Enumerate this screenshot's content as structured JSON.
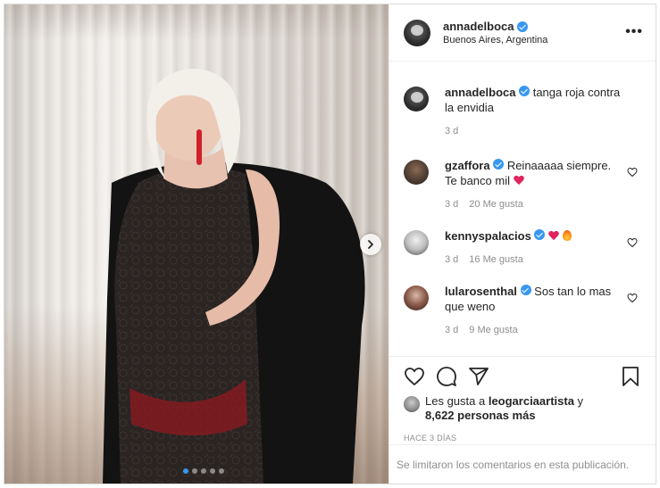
{
  "post": {
    "author": "annadelboca",
    "location": "Buenos Aires, Argentina",
    "more_label": "•••"
  },
  "comments": [
    {
      "user": "annadelboca",
      "text": "tanga roja contra la envidia",
      "time": "3 d",
      "likes": ""
    },
    {
      "user": "gzaffora",
      "text": "Reinaaaaa siempre. Te banco mil",
      "time": "3 d",
      "likes": "20 Me gusta"
    },
    {
      "user": "kennyspalacios",
      "text": "",
      "time": "3 d",
      "likes": "16 Me gusta"
    },
    {
      "user": "lularosenthal",
      "text": "Sos tan lo mas que weno",
      "time": "3 d",
      "likes": "9 Me gusta"
    }
  ],
  "likes": {
    "prefix": "Les gusta a ",
    "user": "leogarciaartista",
    "middle": " y",
    "count": "8,622 personas más"
  },
  "time_ago": "HACE 3 DÍAS",
  "footer": "Se limitaron los comentarios en esta publicación.",
  "carousel": {
    "total_dots": 5,
    "active_index": 0
  },
  "icons": [
    "heart-icon",
    "comment-icon",
    "share-icon",
    "bookmark-icon",
    "chevron-right-icon",
    "verified-icon",
    "more-icon"
  ],
  "colors": {
    "verified": "#3897f0",
    "muted": "#8e8e8e",
    "text": "#262626",
    "border": "#efefef"
  }
}
